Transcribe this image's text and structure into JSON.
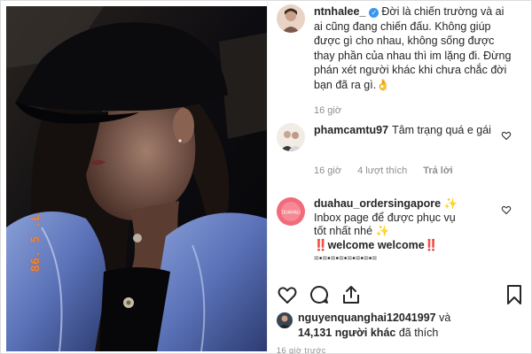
{
  "post": {
    "photo_stamp": "86. 5 .L",
    "author": "ntnhalee_",
    "caption": "Đời là chiến trường và ai ai cũng đang chiến đấu. Không giúp được gì cho nhau, không sống được thay phần của nhau thì im lặng đi. Đừng phán xét người khác khi chưa chắc đời bạn đã ra gì.👌",
    "caption_time": "16 giờ"
  },
  "comments": [
    {
      "username": "phamcamtu97",
      "text": "Tâm trạng quá e gái",
      "time": "16 giờ",
      "likes": "4 lượt thích",
      "reply": "Trả lời"
    },
    {
      "username": "duahau_ordersingapore",
      "lines": [
        "duahau_ordersingapore ✨",
        "Inbox page để được phục vụ",
        "tốt nhất nhé ✨",
        "‼️welcome welcome‼️",
        "=•=•=•=•=•=•=•="
      ],
      "avatar_label": "DUAHAU"
    }
  ],
  "likes": {
    "first_user": "nguyenquanghai12041997",
    "connector": "và",
    "count_text": "14,131 người khác",
    "suffix": "đã thích"
  },
  "footer_time": "16 giờ trước",
  "icons": [
    "heart-icon",
    "comment-icon",
    "share-icon",
    "bookmark-icon",
    "verified-icon"
  ],
  "colors": {
    "verified": "#3897f0",
    "meta": "#8e8e8e",
    "text": "#262626"
  }
}
